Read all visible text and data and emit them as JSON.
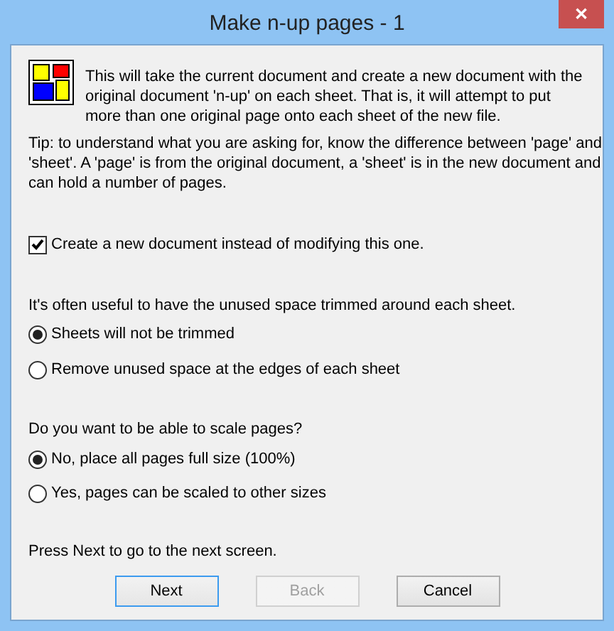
{
  "window": {
    "title": "Make n-up pages - 1",
    "close_label": "✕"
  },
  "intro": "This will take the current document and create a new document with the original document 'n-up' on each sheet.  That is, it will attempt to put more than one original page onto each sheet of the new file.",
  "tip": "Tip: to understand what you are asking for, know the difference between 'page' and 'sheet'.  A 'page' is from the original document, a 'sheet' is in the new document and can hold a number of pages.",
  "new_document": {
    "label": "Create a new document instead of modifying this one.",
    "checked": true
  },
  "trim": {
    "question": "It's often useful to have the unused space trimmed around each sheet.",
    "options": [
      {
        "label": "Sheets will not be trimmed",
        "selected": true
      },
      {
        "label": "Remove unused space at the edges of each sheet",
        "selected": false
      }
    ]
  },
  "scale": {
    "question": "Do you want to be able to scale pages?",
    "options": [
      {
        "label": "No, place all pages full size (100%)",
        "selected": true
      },
      {
        "label": "Yes, pages can be scaled to other sizes",
        "selected": false
      }
    ]
  },
  "footer": "Press Next to go to the next screen.",
  "buttons": [
    {
      "label": "Next",
      "disabled": false,
      "focused": true
    },
    {
      "label": "Back",
      "disabled": true,
      "focused": false
    },
    {
      "label": "Cancel",
      "disabled": false,
      "focused": false
    }
  ]
}
